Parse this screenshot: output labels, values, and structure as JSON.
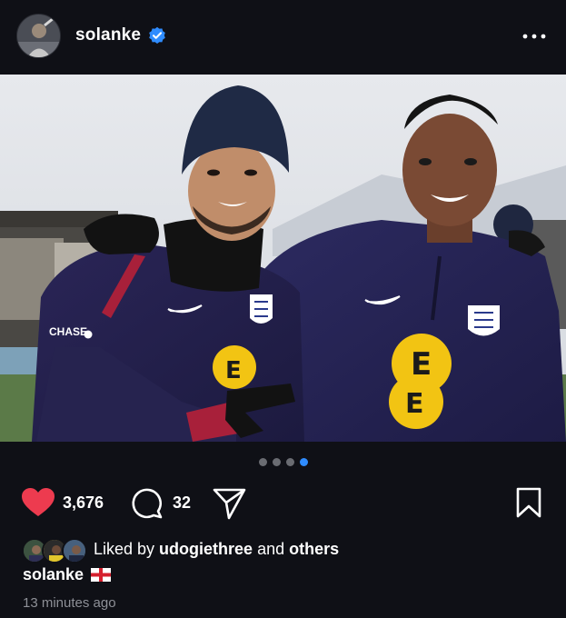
{
  "post": {
    "username": "solanke",
    "verified": true,
    "icons": {
      "avatar": "user-avatar-photo",
      "verified": "verified-badge-icon",
      "more": "more-options-icon"
    }
  },
  "media": {
    "description_icon": "photo",
    "carousel": {
      "total": 4,
      "active_index": 3
    },
    "sponsor_text": "CHASE"
  },
  "actions": {
    "like_count": "3,676",
    "comment_count": "32",
    "liked": true,
    "icons": [
      "heart-icon",
      "comment-icon",
      "share-icon",
      "bookmark-icon"
    ]
  },
  "likes": {
    "prefix": "Liked by ",
    "user": "udogiethree",
    "joiner": " and ",
    "others": "others"
  },
  "caption": {
    "username": "solanke",
    "flag": "england-flag"
  },
  "timestamp": "13 minutes ago",
  "colors": {
    "background": "#0f1016",
    "like_red": "#ed3b4f",
    "accent_blue": "#2f8cff",
    "muted_text": "#8e9097"
  }
}
